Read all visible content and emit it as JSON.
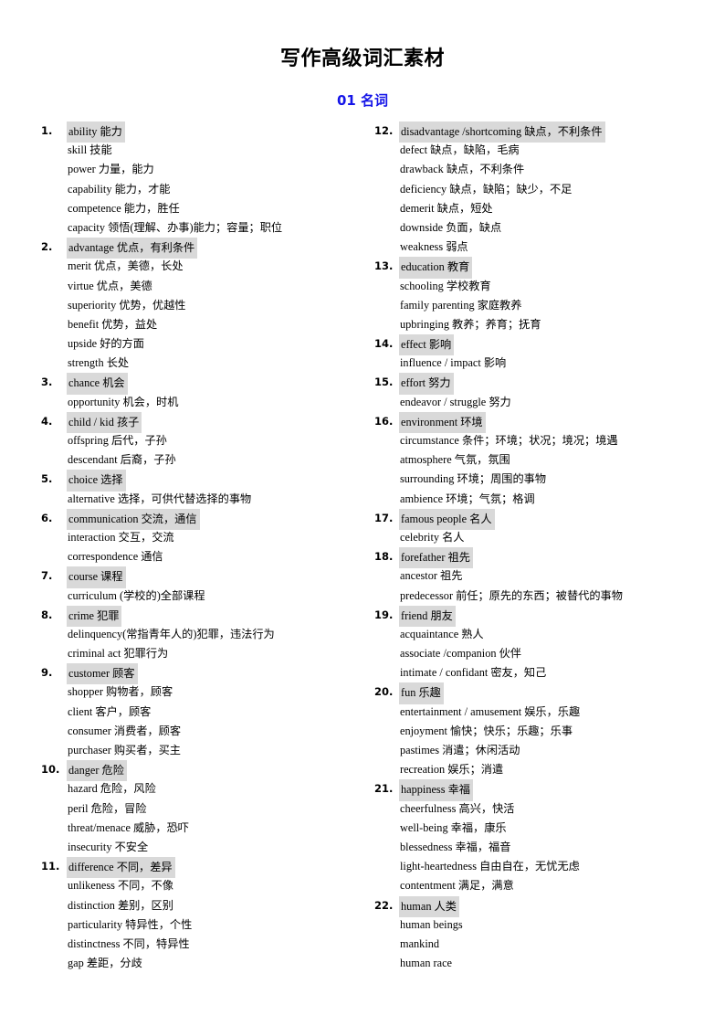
{
  "document": {
    "title": "写作高级词汇素材",
    "section_title": "01  名词",
    "section_title_color": "#1515e8",
    "highlight_color": "#d9d9d9"
  },
  "columns": {
    "left": [
      {
        "number": "1.",
        "headword": "ability  能力",
        "synonyms": [
          "skill 技能",
          "power 力量，能力",
          "capability  能力，才能",
          "competence  能力，胜任",
          "capacity  领悟(理解、办事)能力；容量；职位"
        ]
      },
      {
        "number": "2.",
        "headword": "advantage  优点，有利条件",
        "synonyms": [
          "merit  优点，美德，长处",
          "virtue 优点，美德",
          "superiority  优势，优越性",
          "benefit  优势，益处",
          "upside 好的方面",
          "strength 长处"
        ]
      },
      {
        "number": "3.",
        "headword": "chance  机会",
        "synonyms": [
          "opportunity  机会，时机"
        ]
      },
      {
        "number": "4.",
        "headword": "child / kid 孩子",
        "synonyms": [
          "offspring 后代，子孙",
          "descendant 后裔，子孙"
        ]
      },
      {
        "number": "5.",
        "headword": "choice  选择",
        "synonyms": [
          "alternative  选择，可供代替选择的事物"
        ]
      },
      {
        "number": "6.",
        "headword": "communication 交流，通信",
        "synonyms": [
          "interaction 交互，交流",
          "correspondence 通信"
        ]
      },
      {
        "number": "7.",
        "headword": "course  课程",
        "synonyms": [
          "curriculum (学校的)全部课程"
        ]
      },
      {
        "number": "8.",
        "headword": "crime 犯罪",
        "synonyms": [
          "delinquency(常指青年人的)犯罪，违法行为",
          "criminal act 犯罪行为"
        ]
      },
      {
        "number": "9.",
        "headword": "customer 顾客",
        "synonyms": [
          "shopper 购物者，顾客",
          "client 客户，顾客",
          "consumer 消费者，顾客",
          "purchaser 购买者，买主"
        ]
      },
      {
        "number": "10.",
        "headword": "danger 危险",
        "synonyms": [
          "hazard 危险，风险",
          "peril 危险，冒险",
          "threat/menace 威胁，恐吓",
          "insecurity 不安全"
        ]
      },
      {
        "number": "11.",
        "headword": "difference 不同，差异",
        "synonyms": [
          "unlikeness 不同，不像",
          "distinction 差别，区别",
          "particularity 特异性，个性",
          "distinctness 不同，特异性",
          "gap 差距，分歧"
        ]
      }
    ],
    "right": [
      {
        "number": "12.",
        "headword": "disadvantage /shortcoming 缺点，不利条件",
        "synonyms": [
          "defect  缺点，缺陷，毛病",
          "drawback  缺点，不利条件",
          "deficiency  缺点，缺陷；缺少，不足",
          "demerit 缺点，短处",
          "downside 负面，缺点",
          "weakness 弱点"
        ]
      },
      {
        "number": "13.",
        "headword": "education 教育",
        "synonyms": [
          "schooling 学校教育",
          "family parenting 家庭教养",
          "upbringing 教养；养育；抚育"
        ]
      },
      {
        "number": "14.",
        "headword": "effect  影响",
        "synonyms": [
          "influence / impact   影响"
        ]
      },
      {
        "number": "15.",
        "headword": "effort 努力",
        "synonyms": [
          "endeavor / struggle 努力"
        ]
      },
      {
        "number": "16.",
        "headword": "environment 环境",
        "synonyms": [
          "circumstance 条件；环境；状况；境况；境遇",
          "atmosphere 气氛，氛围",
          "surrounding 环境；周围的事物",
          "ambience 环境；气氛；格调"
        ]
      },
      {
        "number": "17.",
        "headword": "famous people 名人",
        "synonyms": [
          "celebrity 名人"
        ]
      },
      {
        "number": "18.",
        "headword": "forefather 祖先",
        "synonyms": [
          "ancestor 祖先",
          "predecessor 前任；原先的东西；被替代的事物"
        ]
      },
      {
        "number": "19.",
        "headword": "friend  朋友",
        "synonyms": [
          "acquaintance  熟人",
          "associate /companion  伙伴",
          "intimate / confidant  密友，知己"
        ]
      },
      {
        "number": "20.",
        "headword": "fun  乐趣",
        "synonyms": [
          "entertainment / amusement  娱乐，乐趣",
          "enjoyment 愉快；快乐；乐趣；乐事",
          "pastimes 消遣；休闲活动",
          "recreation 娱乐；消遣"
        ]
      },
      {
        "number": "21.",
        "headword": "happiness 幸福",
        "synonyms": [
          "cheerfulness 高兴，快活",
          "well-being 幸福，康乐",
          "blessedness 幸福，福音",
          "light-heartedness 自由自在，无忧无虑",
          "contentment 满足，满意"
        ]
      },
      {
        "number": "22.",
        "headword": "human 人类",
        "synonyms": [
          "human beings",
          "mankind",
          "human race"
        ]
      }
    ]
  }
}
